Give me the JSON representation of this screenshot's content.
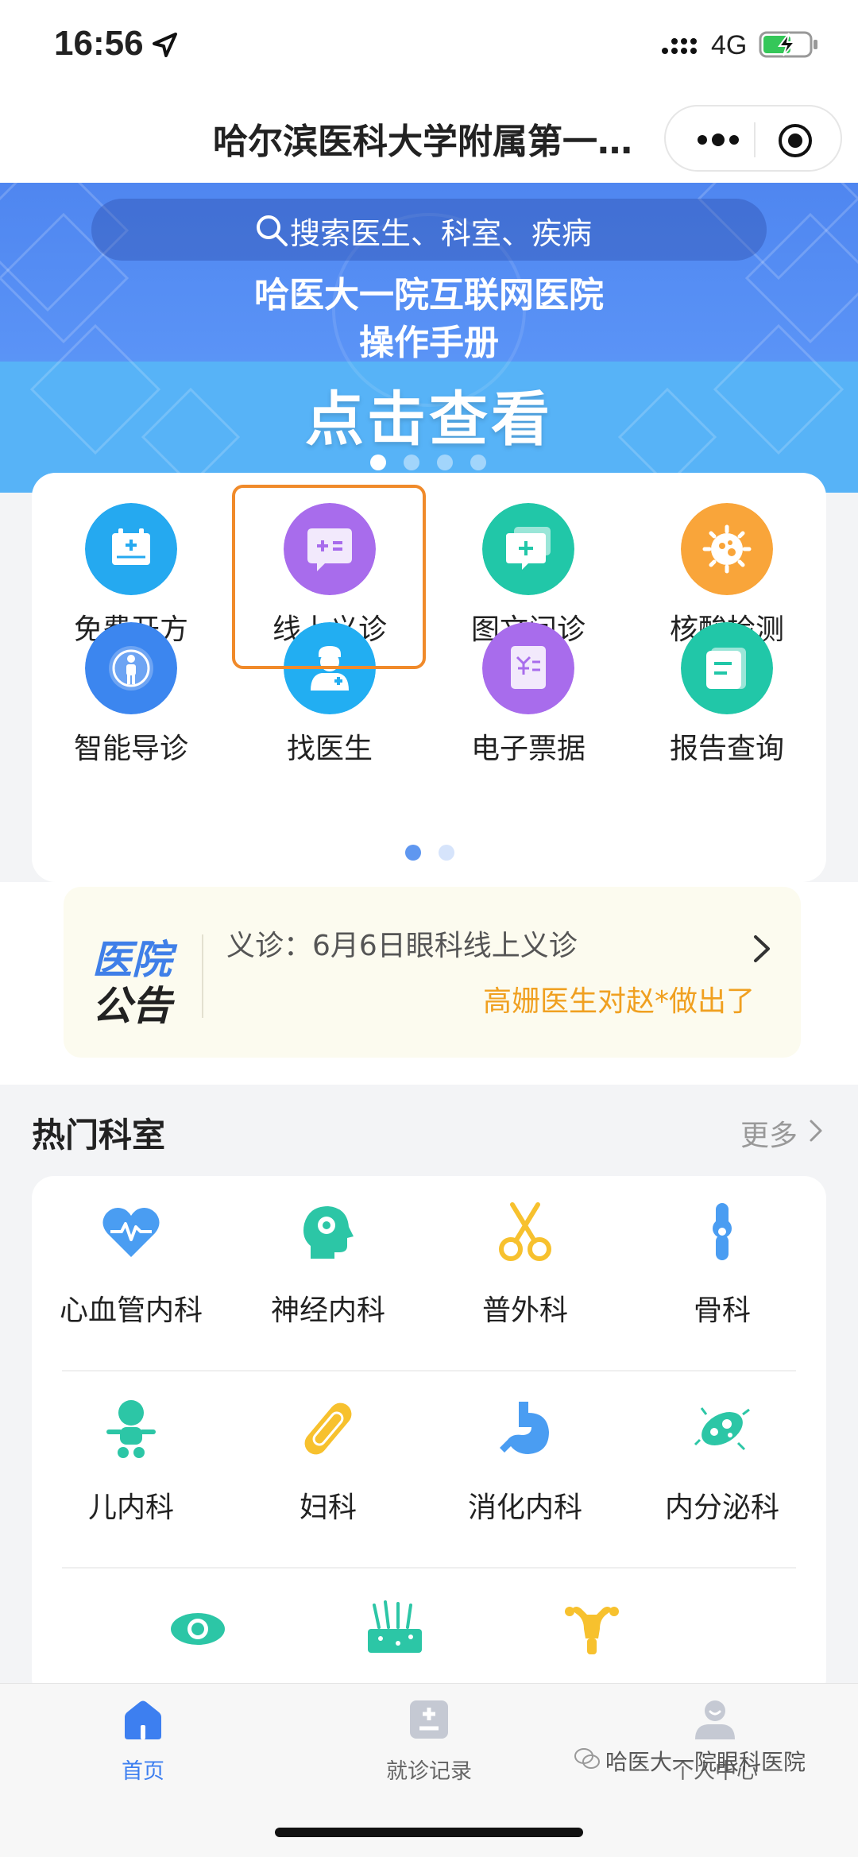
{
  "status_bar": {
    "time": "16:56",
    "network": "4G"
  },
  "nav": {
    "title": "哈尔滨医科大学附属第一…"
  },
  "banner": {
    "search_placeholder": "搜索医生、科室、疾病",
    "title_line1": "哈医大一院互联网医院",
    "title_line2": "操作手册",
    "cta": "点击查看",
    "carousel_active_index": 0,
    "carousel_count": 4
  },
  "services": [
    {
      "label": "免费开方",
      "icon": "prescription-icon",
      "color": "#25a9f0"
    },
    {
      "label": "线上义诊",
      "icon": "chat-consult-icon",
      "color": "#a86cec",
      "highlighted": true
    },
    {
      "label": "图文问诊",
      "icon": "message-plus-icon",
      "color": "#21c7a8"
    },
    {
      "label": "核酸检测",
      "icon": "virus-icon",
      "color": "#f9a53a"
    },
    {
      "label": "智能导诊",
      "icon": "smart-guide-icon",
      "color": "#3c86ef"
    },
    {
      "label": "找医生",
      "icon": "doctor-icon",
      "color": "#22aef2"
    },
    {
      "label": "电子票据",
      "icon": "receipt-icon",
      "color": "#a86cec"
    },
    {
      "label": "报告查询",
      "icon": "report-icon",
      "color": "#21c7a8"
    }
  ],
  "services_page": {
    "active_index": 0,
    "count": 2
  },
  "notice": {
    "logo_line1": "医院",
    "logo_line2": "公告",
    "line1": "义诊：6月6日眼科线上义诊",
    "line2": "高姗医生对赵*做出了"
  },
  "hot_departments": {
    "title": "热门科室",
    "more": "更多",
    "items": [
      {
        "label": "心血管内科",
        "icon": "heart-icon",
        "color": "#4a9df2"
      },
      {
        "label": "神经内科",
        "icon": "brain-head-icon",
        "color": "#2cc6a6"
      },
      {
        "label": "普外科",
        "icon": "scissors-icon",
        "color": "#f7c12e"
      },
      {
        "label": "骨科",
        "icon": "bone-joint-icon",
        "color": "#4a9df2"
      },
      {
        "label": "儿内科",
        "icon": "baby-icon",
        "color": "#2cc6a6"
      },
      {
        "label": "妇科",
        "icon": "pad-icon",
        "color": "#f7c12e"
      },
      {
        "label": "消化内科",
        "icon": "stomach-icon",
        "color": "#4a9df2"
      },
      {
        "label": "内分泌科",
        "icon": "microbe-icon",
        "color": "#2cc6a6"
      },
      {
        "label": "",
        "icon": "eye-icon",
        "color": "#2cc6a6"
      },
      {
        "label": "",
        "icon": "skin-icon",
        "color": "#2cc6a6"
      },
      {
        "label": "",
        "icon": "uterus-icon",
        "color": "#f7c12e"
      }
    ]
  },
  "tabbar": [
    {
      "label": "首页",
      "icon": "home-icon",
      "active": true
    },
    {
      "label": "就诊记录",
      "icon": "record-icon",
      "active": false
    },
    {
      "label": "个人中心",
      "icon": "user-icon",
      "active": false
    }
  ],
  "watermark": "哈医大一院眼科医院",
  "colors": {
    "primary": "#3d7ff0",
    "highlight_border": "#f08a2a",
    "notice_orange": "#f0a020"
  }
}
